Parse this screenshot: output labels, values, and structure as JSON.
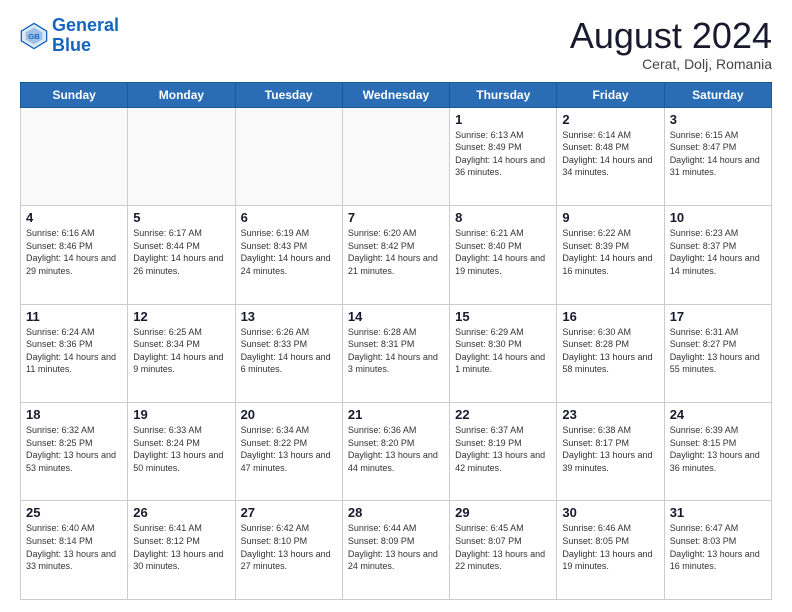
{
  "logo": {
    "line1": "General",
    "line2": "Blue"
  },
  "title": "August 2024",
  "subtitle": "Cerat, Dolj, Romania",
  "days_header": [
    "Sunday",
    "Monday",
    "Tuesday",
    "Wednesday",
    "Thursday",
    "Friday",
    "Saturday"
  ],
  "weeks": [
    [
      {
        "day": "",
        "sunrise": "",
        "sunset": "",
        "daylight": "",
        "empty": true
      },
      {
        "day": "",
        "sunrise": "",
        "sunset": "",
        "daylight": "",
        "empty": true
      },
      {
        "day": "",
        "sunrise": "",
        "sunset": "",
        "daylight": "",
        "empty": true
      },
      {
        "day": "",
        "sunrise": "",
        "sunset": "",
        "daylight": "",
        "empty": true
      },
      {
        "day": "1",
        "sunrise": "6:13 AM",
        "sunset": "8:49 PM",
        "daylight": "14 hours and 36 minutes.",
        "empty": false
      },
      {
        "day": "2",
        "sunrise": "6:14 AM",
        "sunset": "8:48 PM",
        "daylight": "14 hours and 34 minutes.",
        "empty": false
      },
      {
        "day": "3",
        "sunrise": "6:15 AM",
        "sunset": "8:47 PM",
        "daylight": "14 hours and 31 minutes.",
        "empty": false
      }
    ],
    [
      {
        "day": "4",
        "sunrise": "6:16 AM",
        "sunset": "8:46 PM",
        "daylight": "14 hours and 29 minutes.",
        "empty": false
      },
      {
        "day": "5",
        "sunrise": "6:17 AM",
        "sunset": "8:44 PM",
        "daylight": "14 hours and 26 minutes.",
        "empty": false
      },
      {
        "day": "6",
        "sunrise": "6:19 AM",
        "sunset": "8:43 PM",
        "daylight": "14 hours and 24 minutes.",
        "empty": false
      },
      {
        "day": "7",
        "sunrise": "6:20 AM",
        "sunset": "8:42 PM",
        "daylight": "14 hours and 21 minutes.",
        "empty": false
      },
      {
        "day": "8",
        "sunrise": "6:21 AM",
        "sunset": "8:40 PM",
        "daylight": "14 hours and 19 minutes.",
        "empty": false
      },
      {
        "day": "9",
        "sunrise": "6:22 AM",
        "sunset": "8:39 PM",
        "daylight": "14 hours and 16 minutes.",
        "empty": false
      },
      {
        "day": "10",
        "sunrise": "6:23 AM",
        "sunset": "8:37 PM",
        "daylight": "14 hours and 14 minutes.",
        "empty": false
      }
    ],
    [
      {
        "day": "11",
        "sunrise": "6:24 AM",
        "sunset": "8:36 PM",
        "daylight": "14 hours and 11 minutes.",
        "empty": false
      },
      {
        "day": "12",
        "sunrise": "6:25 AM",
        "sunset": "8:34 PM",
        "daylight": "14 hours and 9 minutes.",
        "empty": false
      },
      {
        "day": "13",
        "sunrise": "6:26 AM",
        "sunset": "8:33 PM",
        "daylight": "14 hours and 6 minutes.",
        "empty": false
      },
      {
        "day": "14",
        "sunrise": "6:28 AM",
        "sunset": "8:31 PM",
        "daylight": "14 hours and 3 minutes.",
        "empty": false
      },
      {
        "day": "15",
        "sunrise": "6:29 AM",
        "sunset": "8:30 PM",
        "daylight": "14 hours and 1 minute.",
        "empty": false
      },
      {
        "day": "16",
        "sunrise": "6:30 AM",
        "sunset": "8:28 PM",
        "daylight": "13 hours and 58 minutes.",
        "empty": false
      },
      {
        "day": "17",
        "sunrise": "6:31 AM",
        "sunset": "8:27 PM",
        "daylight": "13 hours and 55 minutes.",
        "empty": false
      }
    ],
    [
      {
        "day": "18",
        "sunrise": "6:32 AM",
        "sunset": "8:25 PM",
        "daylight": "13 hours and 53 minutes.",
        "empty": false
      },
      {
        "day": "19",
        "sunrise": "6:33 AM",
        "sunset": "8:24 PM",
        "daylight": "13 hours and 50 minutes.",
        "empty": false
      },
      {
        "day": "20",
        "sunrise": "6:34 AM",
        "sunset": "8:22 PM",
        "daylight": "13 hours and 47 minutes.",
        "empty": false
      },
      {
        "day": "21",
        "sunrise": "6:36 AM",
        "sunset": "8:20 PM",
        "daylight": "13 hours and 44 minutes.",
        "empty": false
      },
      {
        "day": "22",
        "sunrise": "6:37 AM",
        "sunset": "8:19 PM",
        "daylight": "13 hours and 42 minutes.",
        "empty": false
      },
      {
        "day": "23",
        "sunrise": "6:38 AM",
        "sunset": "8:17 PM",
        "daylight": "13 hours and 39 minutes.",
        "empty": false
      },
      {
        "day": "24",
        "sunrise": "6:39 AM",
        "sunset": "8:15 PM",
        "daylight": "13 hours and 36 minutes.",
        "empty": false
      }
    ],
    [
      {
        "day": "25",
        "sunrise": "6:40 AM",
        "sunset": "8:14 PM",
        "daylight": "13 hours and 33 minutes.",
        "empty": false
      },
      {
        "day": "26",
        "sunrise": "6:41 AM",
        "sunset": "8:12 PM",
        "daylight": "13 hours and 30 minutes.",
        "empty": false
      },
      {
        "day": "27",
        "sunrise": "6:42 AM",
        "sunset": "8:10 PM",
        "daylight": "13 hours and 27 minutes.",
        "empty": false
      },
      {
        "day": "28",
        "sunrise": "6:44 AM",
        "sunset": "8:09 PM",
        "daylight": "13 hours and 24 minutes.",
        "empty": false
      },
      {
        "day": "29",
        "sunrise": "6:45 AM",
        "sunset": "8:07 PM",
        "daylight": "13 hours and 22 minutes.",
        "empty": false
      },
      {
        "day": "30",
        "sunrise": "6:46 AM",
        "sunset": "8:05 PM",
        "daylight": "13 hours and 19 minutes.",
        "empty": false
      },
      {
        "day": "31",
        "sunrise": "6:47 AM",
        "sunset": "8:03 PM",
        "daylight": "13 hours and 16 minutes.",
        "empty": false
      }
    ]
  ]
}
